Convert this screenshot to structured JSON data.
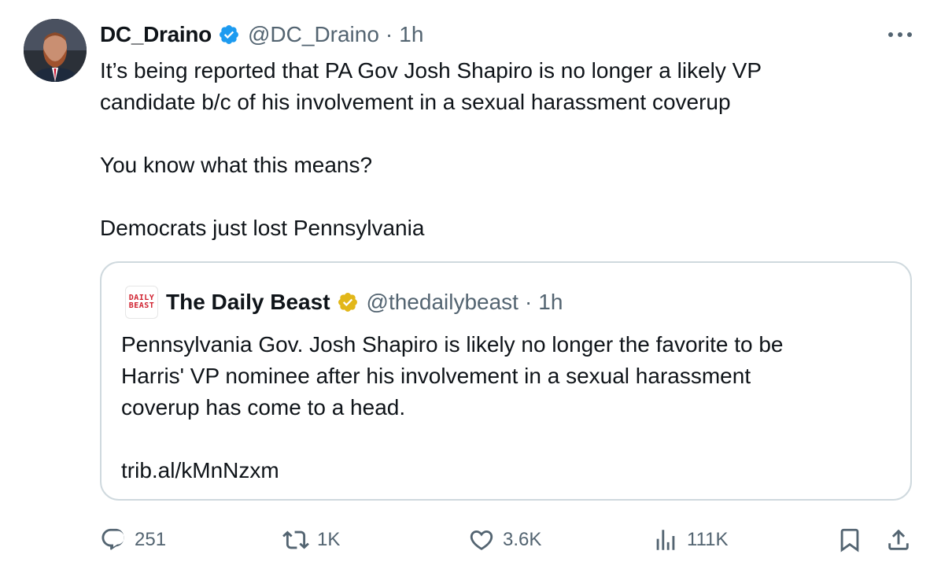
{
  "author": {
    "name": "DC_Draino",
    "handle": "@DC_Draino",
    "separator": "·",
    "time": "1h",
    "avatar_icon": "profile-photo-avatar",
    "verified_color": "#1d9bf0"
  },
  "tweet": {
    "lines": [
      "It’s being reported that PA Gov Josh Shapiro is no longer a likely VP",
      "candidate b/c of his involvement in a sexual harassment coverup",
      "You know what this means?",
      "Democrats just lost Pennsylvania"
    ]
  },
  "quote": {
    "logo_text_top": "DAILY",
    "logo_text_bottom": "BEAST",
    "name": "The Daily Beast",
    "handle": "@thedailybeast",
    "separator": "·",
    "time": "1h",
    "verified_color": "#e2b719",
    "lines": [
      "Pennsylvania Gov. Josh Shapiro is likely no longer the favorite to be",
      "Harris' VP nominee after his involvement in a sexual harassment",
      "coverup has come to a head.",
      "trib.al/kMnNzxm"
    ]
  },
  "actions": {
    "replies": "251",
    "reposts": "1K",
    "likes": "3.6K",
    "views": "111K"
  },
  "colors": {
    "text": "#0f1419",
    "muted": "#536471",
    "border": "#cfd9de"
  }
}
